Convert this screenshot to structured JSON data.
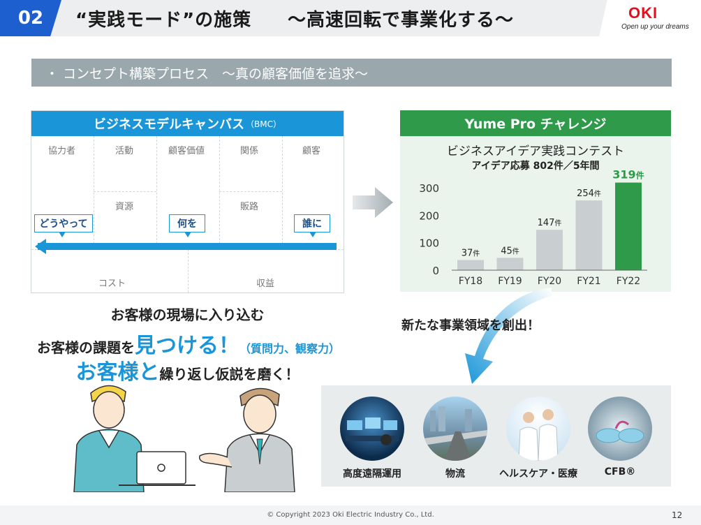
{
  "header": {
    "section_number": "02",
    "title": "“実践モード”の施策",
    "subtitle": "～高速回転で事業化する～",
    "logo_text": "OKI",
    "tagline": "Open up your dreams"
  },
  "banner": {
    "text": "・ コンセプト構築プロセス　～真の顧客価値を追求～"
  },
  "bmc": {
    "title": "ビジネスモデルキャンバス",
    "title_suffix": "（BMC）",
    "cells": {
      "partners": "協力者",
      "activities": "活動",
      "value": "顧客価値",
      "relationships": "関係",
      "customers": "顧客",
      "resources": "資源",
      "channels": "販路",
      "cost": "コスト",
      "revenue": "収益"
    },
    "callouts": {
      "how": "どうやって",
      "what": "何を",
      "who": "誰に"
    }
  },
  "messages": {
    "line1": "お客様の現場に入り込む",
    "line2_pre": "お客様の課題を",
    "line2_big": "見つける！",
    "line2_paren": "（質問力、観察力）",
    "line3_big": "お客様と",
    "line3_post": "繰り返し仮説を磨く！"
  },
  "yume": {
    "header": "Yume Pro チャレンジ",
    "contest_title": "ビジネスアイデア実践コンテスト",
    "contest_subtitle": "アイデア応募 802件／5年間"
  },
  "chart_data": {
    "type": "bar",
    "categories": [
      "FY18",
      "FY19",
      "FY20",
      "FY21",
      "FY22"
    ],
    "values": [
      37,
      45,
      147,
      254,
      319
    ],
    "value_unit": "件",
    "ylim": [
      0,
      300
    ],
    "yticks": [
      0,
      100,
      200,
      300
    ],
    "bar_colors": [
      "#c9ced1",
      "#c9ced1",
      "#c9ced1",
      "#c9ced1",
      "#2e9a4a"
    ]
  },
  "new_business": "新たな事業領域を創出！",
  "domains": [
    {
      "label": "高度遠隔運用"
    },
    {
      "label": "物流"
    },
    {
      "label": "ヘルスケア・医療"
    },
    {
      "label": "CFB®"
    }
  ],
  "footer": {
    "copyright": "© Copyright 2023 Oki Electric Industry Co., Ltd.",
    "page_number": "12"
  }
}
